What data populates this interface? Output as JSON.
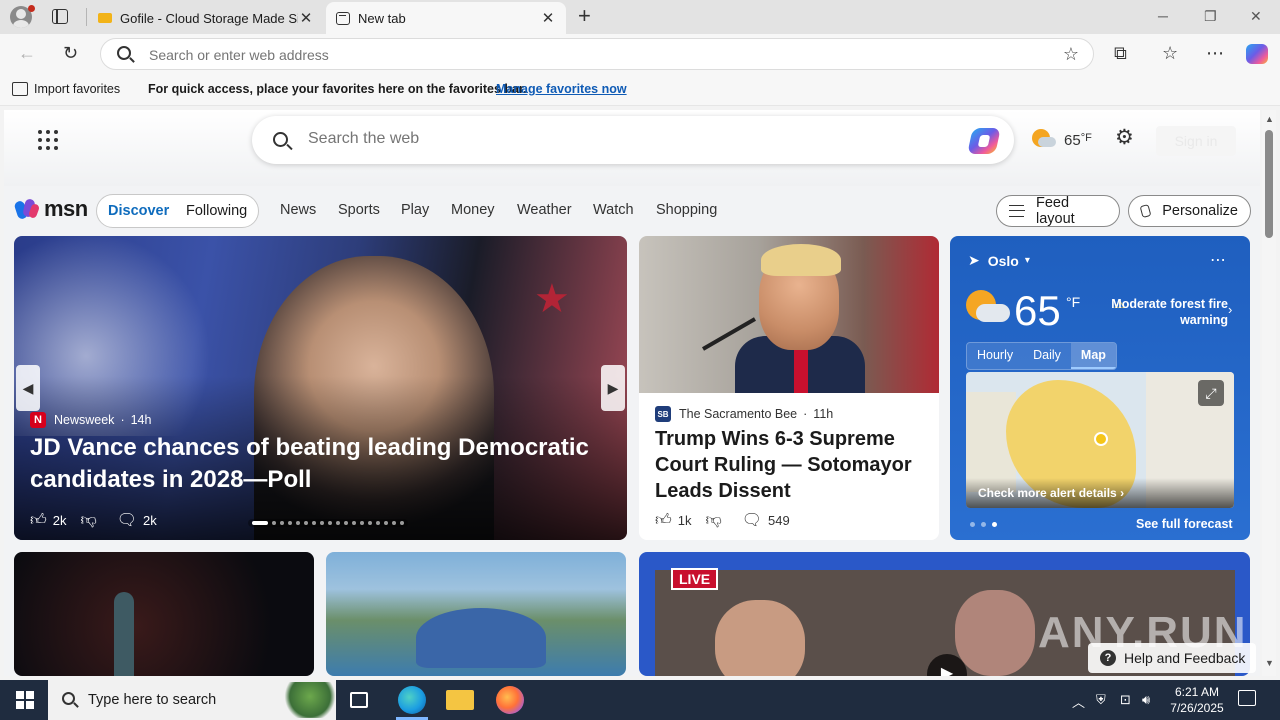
{
  "browser": {
    "tabs": [
      {
        "title": "Gofile - Cloud Storage Made Simple",
        "active": false
      },
      {
        "title": "New tab",
        "active": true
      }
    ],
    "address_placeholder": "Search or enter web address",
    "favorites_bar": {
      "import_label": "Import favorites",
      "message": "For quick access, place your favorites here on the favorites bar.",
      "link": "Manage favorites now"
    }
  },
  "header": {
    "search_placeholder": "Search the web",
    "temperature": "65",
    "unit": "°F",
    "sign_in": "Sign in"
  },
  "nav": {
    "logo_text": "msn",
    "segment": [
      "Discover",
      "Following"
    ],
    "items": [
      "News",
      "Sports",
      "Play",
      "Money",
      "Weather",
      "Watch",
      "Shopping"
    ],
    "feed_layout": "Feed layout",
    "personalize": "Personalize"
  },
  "hero": {
    "source_logo": "N",
    "source": "Newsweek",
    "age": "14h",
    "title": "JD Vance chances of beating leading Democratic candidates in 2028—Poll",
    "likes": "2k",
    "comments": "2k"
  },
  "trump_card": {
    "source_logo": "SB",
    "source": "The Sacramento Bee",
    "age": "11h",
    "title": "Trump Wins 6-3 Supreme Court Ruling — Sotomayor Leads Dissent",
    "likes": "1k",
    "comments": "549"
  },
  "weather": {
    "location": "Oslo",
    "temperature": "65",
    "unit": "°F",
    "alert": "Moderate forest fire warning",
    "tabs": [
      "Hourly",
      "Daily",
      "Map"
    ],
    "selected_tab": "Map",
    "map_footer": "Check more alert details",
    "forecast_link": "See full forecast"
  },
  "live": {
    "badge": "LIVE"
  },
  "help": {
    "label": "Help and Feedback"
  },
  "watermark": "ANY.RUN",
  "taskbar": {
    "search_placeholder": "Type here to search",
    "time": "6:21 AM",
    "date": "7/26/2025"
  },
  "colors": {
    "accent": "#0f6cbd",
    "weather_bg": "#1f5fbf",
    "taskbar": "#1f2c3f"
  }
}
